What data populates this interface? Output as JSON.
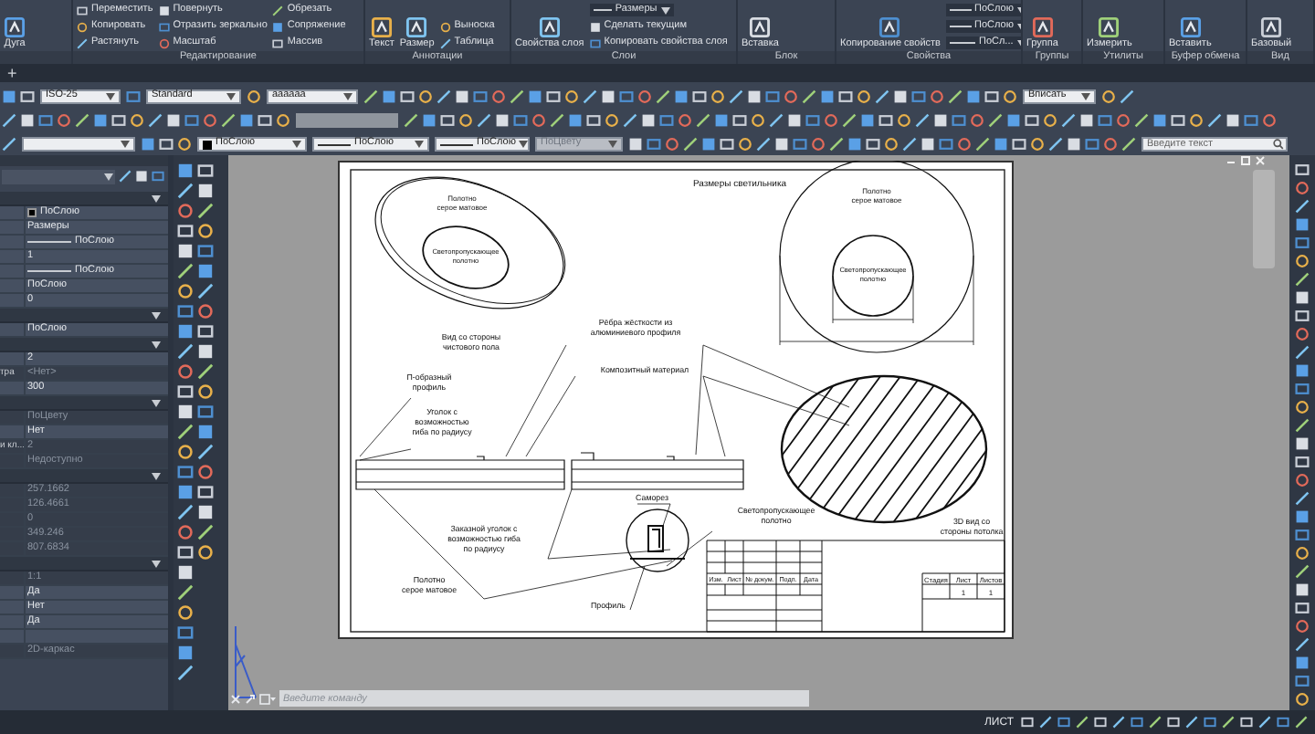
{
  "ribbon": {
    "panels": [
      {
        "tools": [
          {
            "kind": "large",
            "label": "Дуга"
          }
        ]
      },
      {
        "title": "Редактирование",
        "tools": [
          {
            "kind": "small",
            "label": "Переместить"
          },
          {
            "kind": "small",
            "label": "Копировать"
          },
          {
            "kind": "small",
            "label": "Растянуть"
          },
          {
            "kind": "small",
            "label": "Повернуть"
          },
          {
            "kind": "small",
            "label": "Отразить зеркально"
          },
          {
            "kind": "small",
            "label": "Масштаб"
          },
          {
            "kind": "small",
            "label": "Обрезать"
          },
          {
            "kind": "small",
            "label": "Сопряжение"
          },
          {
            "kind": "small",
            "label": "Массив"
          }
        ]
      },
      {
        "title": "Аннотации",
        "tools": [
          {
            "kind": "large",
            "label": "Текст"
          },
          {
            "kind": "large",
            "label": "Размер"
          },
          {
            "kind": "small",
            "label": "Выноска"
          },
          {
            "kind": "small",
            "label": "Таблица"
          }
        ]
      },
      {
        "title": "Слои",
        "tools": [
          {
            "kind": "large",
            "label": "Свойства слоя"
          },
          {
            "kind": "combo",
            "label": "Размеры"
          },
          {
            "kind": "small",
            "label": "Сделать текущим"
          },
          {
            "kind": "small",
            "label": "Копировать свойства слоя"
          }
        ]
      },
      {
        "title": "Блок",
        "tools": [
          {
            "kind": "large",
            "label": "Вставка"
          }
        ]
      },
      {
        "title": "Свойства",
        "tools": [
          {
            "kind": "large",
            "label": "Копирование свойств"
          },
          {
            "kind": "combo",
            "label": "ПоСлою"
          },
          {
            "kind": "combo",
            "label": "ПоСлою"
          },
          {
            "kind": "combo",
            "label": "ПоСл..."
          }
        ]
      },
      {
        "title": "Группы",
        "tools": [
          {
            "kind": "large",
            "label": "Группа"
          }
        ]
      },
      {
        "title": "Утилиты",
        "tools": [
          {
            "kind": "large",
            "label": "Измерить"
          }
        ]
      },
      {
        "title": "Буфер обмена",
        "tools": [
          {
            "kind": "large",
            "label": "Вставить"
          }
        ]
      },
      {
        "title": "Вид",
        "tools": [
          {
            "kind": "large",
            "label": "Базовый"
          }
        ]
      }
    ]
  },
  "file_tabs": {
    "new_tab": "+"
  },
  "toolbars": [
    {
      "items": [
        {
          "kind": "combo",
          "value": "ISO-25"
        },
        {
          "kind": "combo",
          "value": "Standard"
        },
        {
          "kind": "combo",
          "value": "aaaaaa"
        },
        {
          "kind": "combo",
          "value": "Вписать"
        }
      ]
    },
    {
      "items": [
        {
          "kind": "layer"
        },
        {
          "kind": "color",
          "value": "ПоСлою"
        },
        {
          "kind": "linetype",
          "value": "ПоСлою"
        },
        {
          "kind": "linetype",
          "value": "ПоСлою"
        },
        {
          "kind": "combo",
          "value": "ПоЦвету",
          "disabled": true
        },
        {
          "kind": "search",
          "placeholder": "Введите текст"
        }
      ]
    }
  ],
  "properties": {
    "sections": [
      {
        "rows": [
          {
            "kind": "color",
            "value": "ПоСлою",
            "disabled": false
          },
          {
            "kind": "text",
            "value": "Размеры",
            "disabled": false
          },
          {
            "kind": "line",
            "value": "ПоСлою",
            "disabled": false
          },
          {
            "kind": "text",
            "value": "1",
            "disabled": false
          },
          {
            "kind": "line",
            "value": "ПоСлою",
            "disabled": false
          },
          {
            "kind": "text",
            "value": "ПоСлою",
            "disabled": false
          },
          {
            "kind": "text",
            "value": "0",
            "disabled": false
          }
        ]
      },
      {
        "rows": [
          {
            "kind": "text",
            "value": "ПоСлою",
            "disabled": false
          }
        ]
      },
      {
        "rows": [
          {
            "kind": "text",
            "value": "2",
            "disabled": false
          },
          {
            "kind": "text",
            "label": "тра",
            "value": "<Нет>",
            "disabled": true
          },
          {
            "kind": "text",
            "value": "300",
            "disabled": false
          }
        ]
      },
      {
        "rows": [
          {
            "kind": "text",
            "value": "ПоЦвету",
            "disabled": true
          },
          {
            "kind": "text",
            "value": "Нет",
            "disabled": false
          },
          {
            "kind": "text",
            "label": "и кл...",
            "value": "2",
            "disabled": true
          },
          {
            "kind": "text",
            "value": "Недоступно",
            "disabled": true
          }
        ]
      },
      {
        "rows": [
          {
            "kind": "text",
            "value": "257.1662",
            "disabled": true
          },
          {
            "kind": "text",
            "value": "126.4661",
            "disabled": true
          },
          {
            "kind": "text",
            "value": "0",
            "disabled": true
          },
          {
            "kind": "text",
            "value": "349.246",
            "disabled": true
          },
          {
            "kind": "text",
            "value": "807.6834",
            "disabled": true
          }
        ]
      },
      {
        "rows": [
          {
            "kind": "text",
            "value": "1:1",
            "disabled": true
          },
          {
            "kind": "text",
            "value": "Да",
            "disabled": false
          },
          {
            "kind": "text",
            "value": "Нет",
            "disabled": false
          },
          {
            "kind": "text",
            "value": "Да",
            "disabled": false
          },
          {
            "kind": "blank",
            "disabled": false
          },
          {
            "kind": "text",
            "value": "2D-каркас",
            "disabled": true
          }
        ]
      }
    ]
  },
  "drawing": {
    "labels": [
      {
        "lines": [
          "Размеры светильника"
        ]
      },
      {
        "lines": [
          "Полотно",
          "серое матовое"
        ]
      },
      {
        "lines": [
          "Светопропускающее",
          "полотно"
        ]
      },
      {
        "lines": [
          "Вид со стороны",
          "чистового пола"
        ]
      },
      {
        "lines": [
          "Полотно",
          "серое матовое"
        ]
      },
      {
        "lines": [
          "Светопропускающее",
          "полотно"
        ]
      },
      {
        "lines": [
          "Рёбра жёсткости из",
          "алюминиевого профиля"
        ]
      },
      {
        "lines": [
          "Композитный материал"
        ]
      },
      {
        "lines": [
          "П-образный",
          "профиль"
        ]
      },
      {
        "lines": [
          "Уголок с",
          "возможностью",
          "гиба по радиусу"
        ]
      },
      {
        "lines": [
          "Саморез"
        ]
      },
      {
        "lines": [
          "Светопропускающее",
          "полотно"
        ]
      },
      {
        "lines": [
          "Заказной уголок с",
          "возможностью гиба",
          "по радиусу"
        ]
      },
      {
        "lines": [
          "Полотно",
          "серое матовое"
        ]
      },
      {
        "lines": [
          "Профиль"
        ]
      },
      {
        "lines": [
          "3D вид со",
          "стороны потолка"
        ]
      }
    ],
    "title_block": {
      "headers": [
        "Изм.",
        "Лист",
        "№ докум.",
        "Подп.",
        "Дата"
      ],
      "stage_headers": [
        "Стадия",
        "Лист",
        "Листов"
      ],
      "stage_values": [
        "1",
        "1"
      ]
    }
  },
  "command_line": {
    "placeholder": "Введите команду"
  },
  "status_bar": {
    "items": [
      "ЛИСТ"
    ]
  }
}
